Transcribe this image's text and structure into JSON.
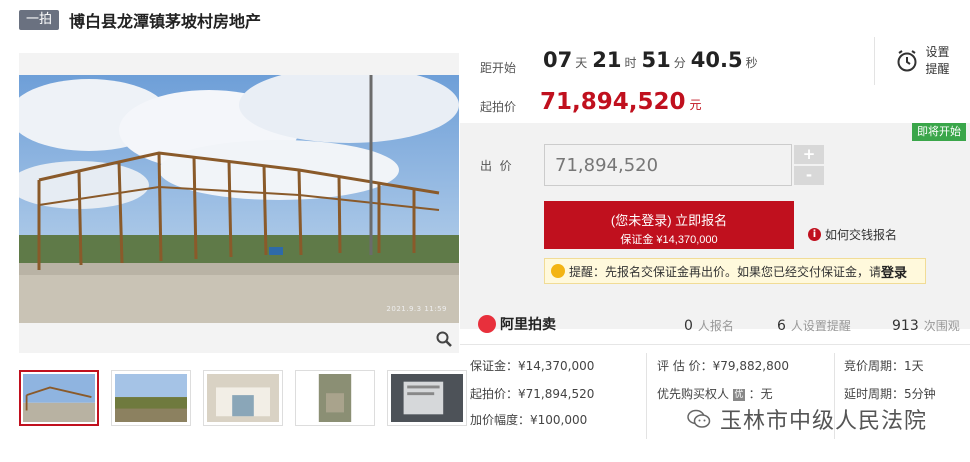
{
  "header": {
    "tag": "一拍",
    "title": "博白县龙潭镇茅坡村房地产"
  },
  "photo": {
    "timestamp": "2021.9.3 11:59",
    "zoom_icon": "search-icon"
  },
  "countdown": {
    "label": "距开始",
    "days": "07",
    "days_unit": "天",
    "hours": "21",
    "hours_unit": "时",
    "minutes": "51",
    "minutes_unit": "分",
    "seconds": "40.5",
    "seconds_unit": "秒"
  },
  "remind": {
    "icon": "alarm-clock-icon",
    "line1": "设置",
    "line2": "提醒"
  },
  "start_price": {
    "label": "起拍价",
    "value": "71,894,520",
    "unit": "元"
  },
  "status_badge": "即将开始",
  "bid": {
    "label": "出  价",
    "input_value": "71,894,520",
    "plus": "+",
    "minus": "-",
    "apply_main": "(您未登录) 立即报名",
    "apply_sub": "保证金 ¥14,370,000",
    "howto": "如何交钱报名"
  },
  "hint": {
    "text": "提醒：先报名交保证金再出价。如果您已经交付保证金，请",
    "link": "登录"
  },
  "platform": {
    "name": "阿里拍卖"
  },
  "stats": [
    {
      "num": "0",
      "label": "人报名"
    },
    {
      "num": "6",
      "label": "人设置提醒"
    },
    {
      "num": "913",
      "label": "次围观"
    }
  ],
  "details": {
    "deposit": "保证金：¥14,370,000",
    "start": "起拍价：¥71,894,520",
    "increment": "加价幅度：¥100,000",
    "appraisal": "评 估 价：¥79,882,800",
    "priority_label": "优先购买权人",
    "priority_badge": "优",
    "priority_value": "：无",
    "cycle": "竞价周期：1天",
    "delay": "延时周期：5分钟"
  },
  "watermark": {
    "text": "玉林市中级人民法院"
  },
  "colors": {
    "accent": "#c0101e",
    "badge_green": "#3aa64a",
    "tag_gray": "#6a7180"
  }
}
